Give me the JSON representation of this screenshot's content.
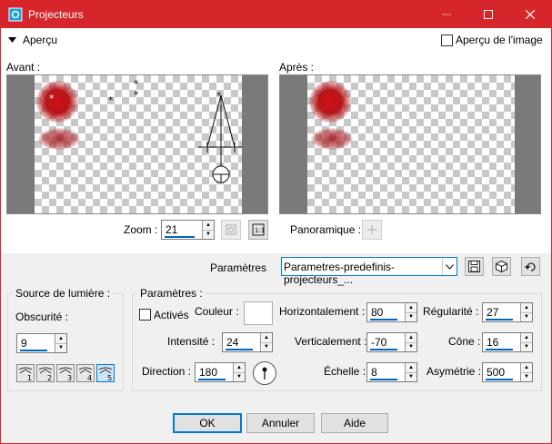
{
  "window": {
    "title": "Projecteurs",
    "accent": "#d6262b"
  },
  "apercu": {
    "label": "Aperçu",
    "image_label": "Aperçu de l'image",
    "avant": "Avant :",
    "apres": "Après :"
  },
  "zoom": {
    "label": "Zoom :",
    "value": "21"
  },
  "pan": {
    "label": "Panoramique :"
  },
  "preset": {
    "label": "Paramètres",
    "value": "Parametres-predefinis-projecteurs_..."
  },
  "light": {
    "title": "Source de lumière :",
    "obscurite_label": "Obscurité :",
    "obscurite_value": "9",
    "buttons": [
      "1",
      "2",
      "3",
      "4",
      "5"
    ],
    "selected": "5"
  },
  "params": {
    "title": "Paramètres :",
    "actives_label": "Activés",
    "couleur_label": "Couleur :",
    "couleur_value": "#ffffff",
    "intensite_label": "Intensité :",
    "intensite_value": "24",
    "direction_label": "Direction :",
    "direction_value": "180",
    "horizontal_label": "Horizontalement :",
    "horizontal_value": "80",
    "vertical_label": "Verticalement :",
    "vertical_value": "-70",
    "echelle_label": "Échelle :",
    "echelle_value": "8",
    "regularite_label": "Régularité :",
    "regularite_value": "27",
    "cone_label": "Cône :",
    "cone_value": "16",
    "asymetrie_label": "Asymétrie :",
    "asymetrie_value": "500"
  },
  "buttons": {
    "ok": "OK",
    "cancel": "Annuler",
    "help": "Aide"
  }
}
